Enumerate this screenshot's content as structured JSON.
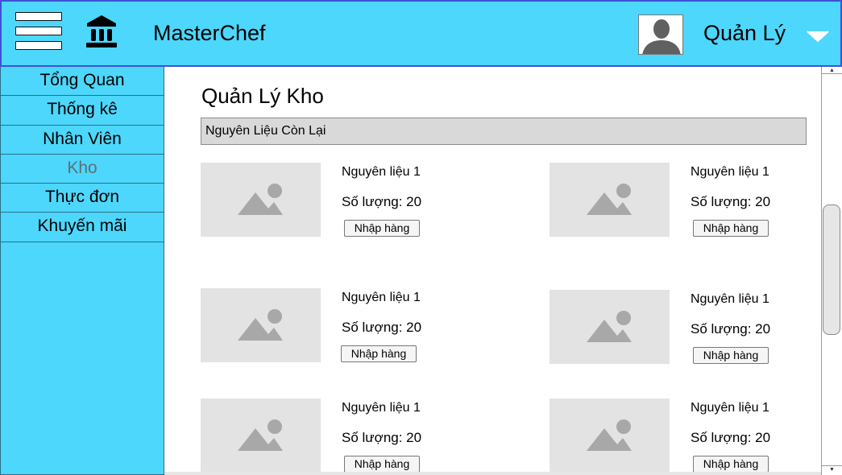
{
  "header": {
    "app_title": "MasterChef",
    "user_name": "Quản Lý",
    "menu_icon": "hamburger-menu-icon",
    "logo_icon": "bank-building-icon",
    "avatar_icon": "user-avatar-icon",
    "dropdown_icon": "chevron-down-icon",
    "background_color": "#4dd7fc"
  },
  "sidebar": {
    "items": [
      {
        "label": "Tổng Quan",
        "active": false
      },
      {
        "label": "Thống kê",
        "active": false
      },
      {
        "label": "Nhân Viên",
        "active": false
      },
      {
        "label": "Kho",
        "active": true
      },
      {
        "label": "Thực đơn",
        "active": false
      },
      {
        "label": "Khuyến mãi",
        "active": false
      }
    ]
  },
  "main": {
    "page_title": "Quản Lý Kho",
    "section_title": "Nguyên Liệu Còn Lại",
    "items": [
      {
        "name": "Nguyên liệu 1",
        "quantity": "Số lượng: 20",
        "button": "Nhập hàng",
        "image_icon": "image-placeholder-icon"
      },
      {
        "name": "Nguyên liệu 1",
        "quantity": "Số lượng: 20",
        "button": "Nhập hàng",
        "image_icon": "image-placeholder-icon"
      },
      {
        "name": "Nguyên liệu 1",
        "quantity": "Số lượng: 20",
        "button": "Nhập hàng",
        "image_icon": "image-placeholder-icon"
      },
      {
        "name": "Nguyên liệu 1",
        "quantity": "Số lượng: 20",
        "button": "Nhập hàng",
        "image_icon": "image-placeholder-icon"
      },
      {
        "name": "Nguyên liệu 1",
        "quantity": "Số lượng: 20",
        "button": "Nhập hàng",
        "image_icon": "image-placeholder-icon"
      },
      {
        "name": "Nguyên liệu 1",
        "quantity": "Số lượng: 20",
        "button": "Nhập hàng",
        "image_icon": "image-placeholder-icon"
      }
    ]
  }
}
